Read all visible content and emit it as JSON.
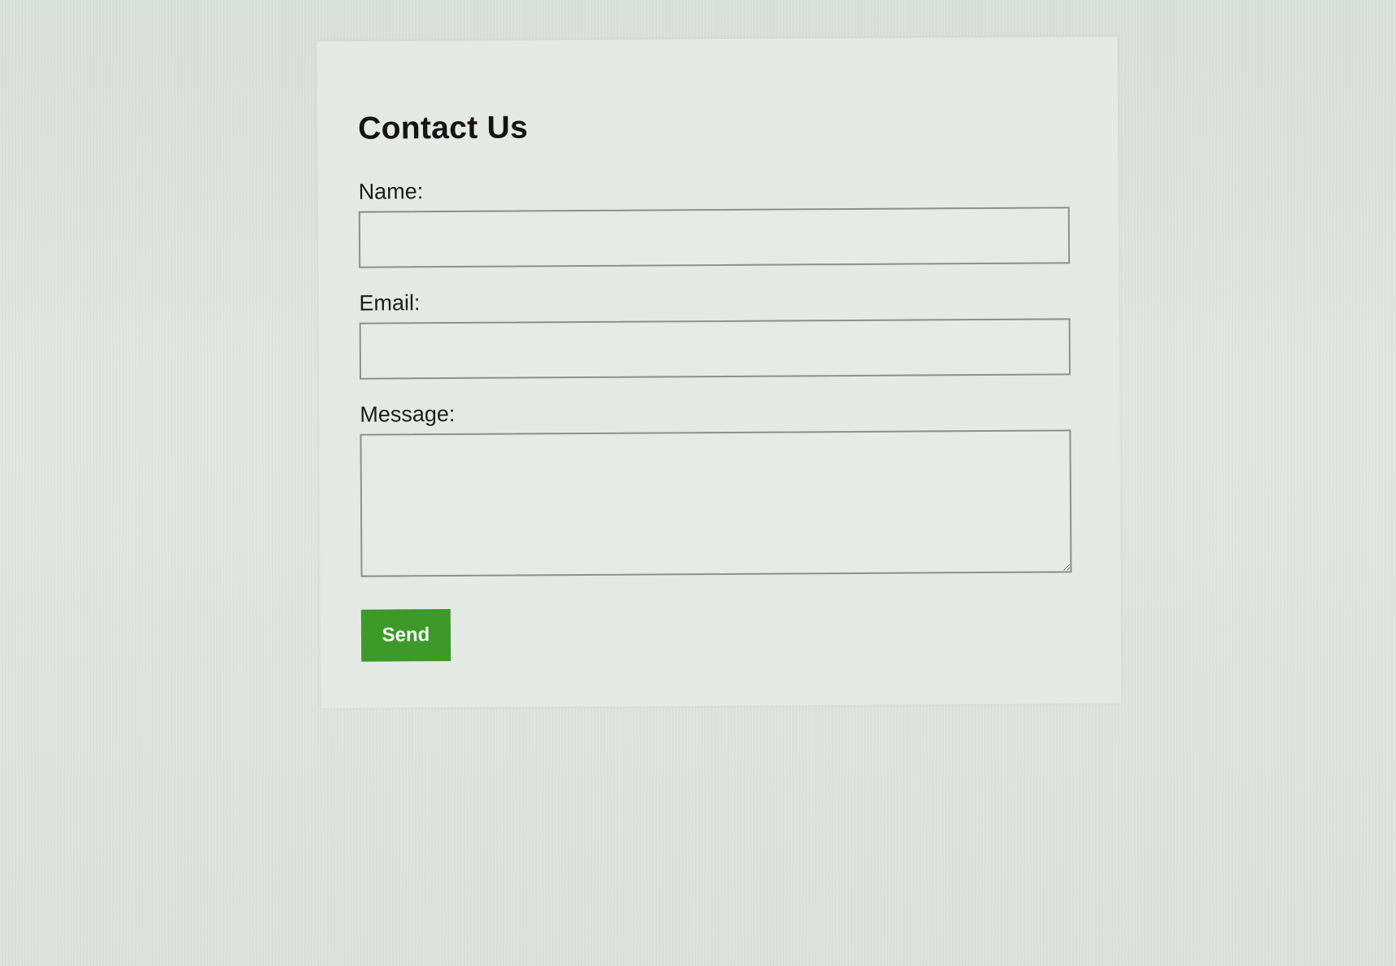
{
  "form": {
    "title": "Contact Us",
    "name_label": "Name:",
    "name_value": "",
    "email_label": "Email:",
    "email_value": "",
    "message_label": "Message:",
    "message_value": "",
    "send_label": "Send"
  },
  "colors": {
    "accent": "#3d9a2a",
    "background": "#dde2dd",
    "card": "#e6eae6"
  }
}
